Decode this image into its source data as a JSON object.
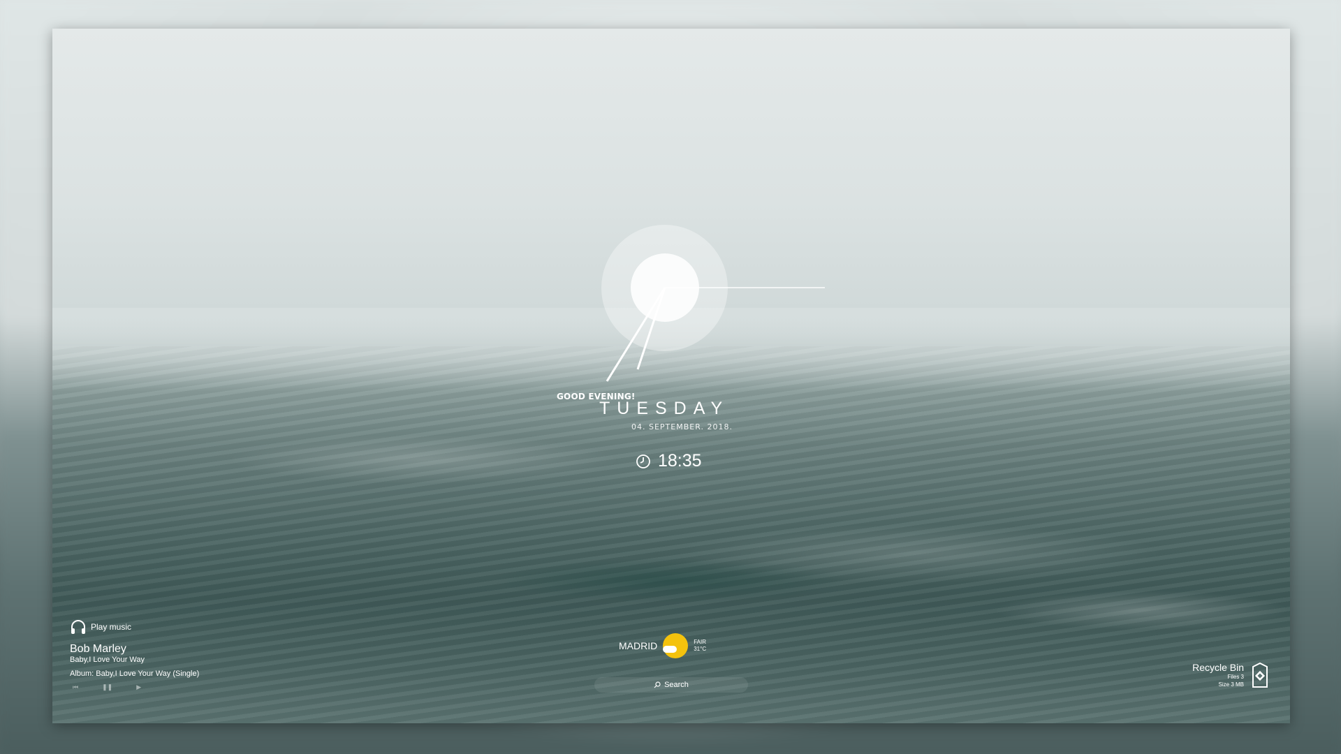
{
  "greeting": "GOOD EVENING!",
  "day": "TUESDAY",
  "date": "04. SEPTEMBER. 2018.",
  "time": "18:35",
  "weather": {
    "city": "MADRID",
    "condition": "FAIR",
    "temperature": "31°C",
    "sun_color": "#f4c20d"
  },
  "search": {
    "label": "Search"
  },
  "music": {
    "play_label": "Play music",
    "artist": "Bob Marley",
    "track": "Baby,I Love Your Way",
    "album": "Album: Baby,I Love Your Way (Single)",
    "controls": [
      "previous-icon",
      "pause-icon",
      "next-icon"
    ]
  },
  "recycle_bin": {
    "title": "Recycle Bin",
    "files": "Files 3",
    "size": "Size 3 MB"
  }
}
